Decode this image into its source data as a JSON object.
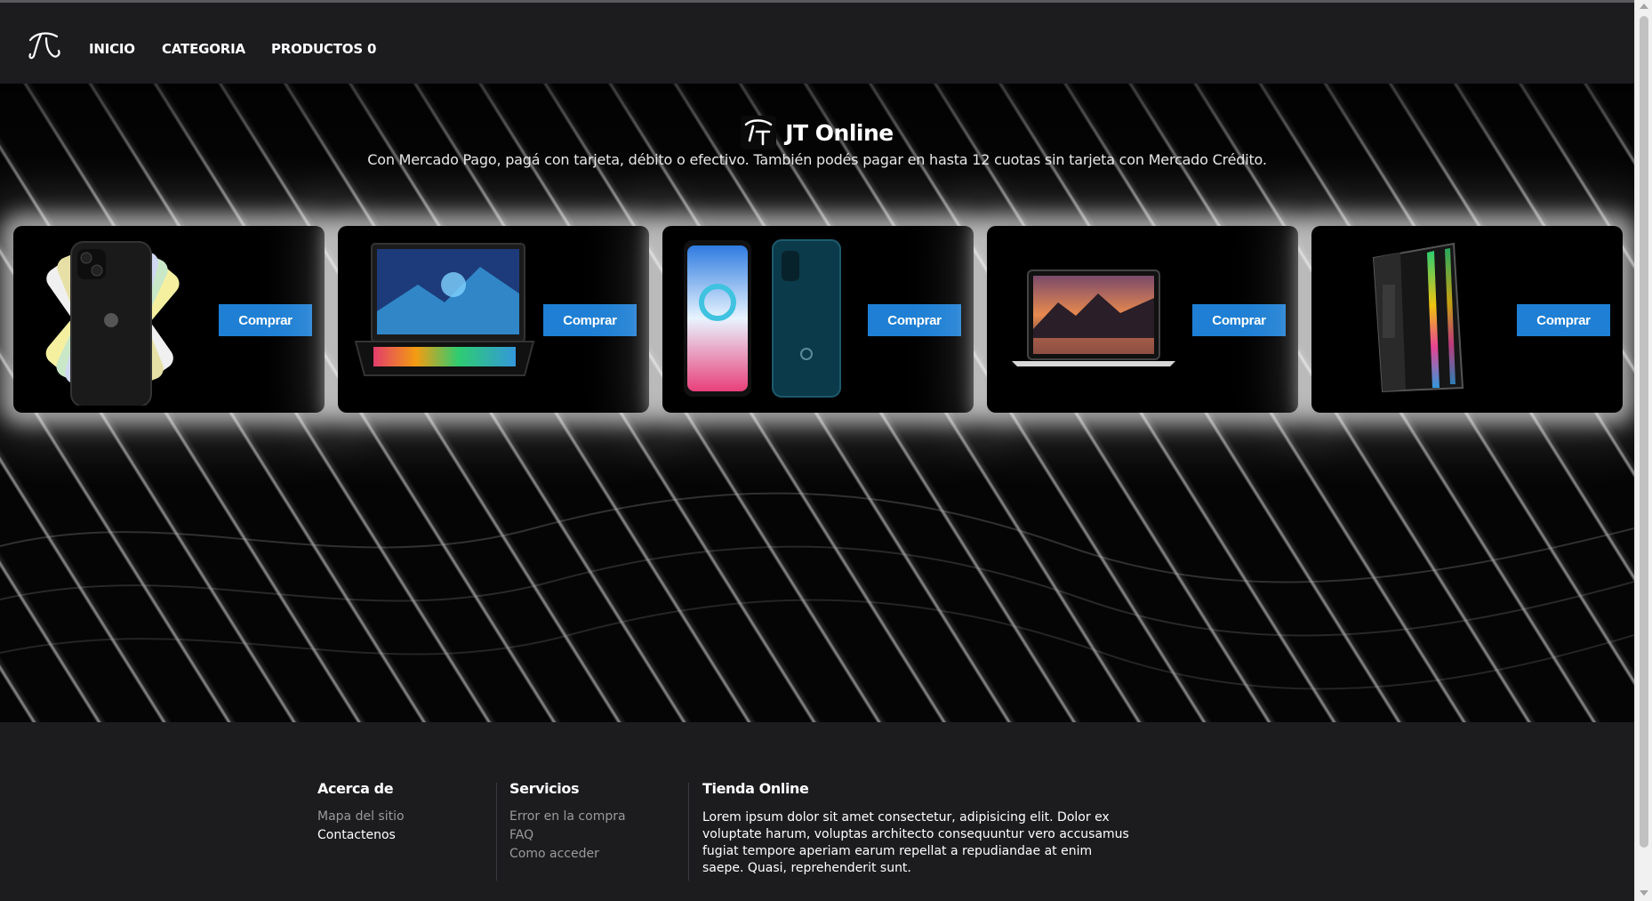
{
  "nav": {
    "logo_icon": "jt-signature-logo",
    "links": [
      "INICIO",
      "CATEGORIA",
      "PRODUCTOS 0"
    ]
  },
  "hero": {
    "logo_icon": "jt-logo",
    "title": "JT Online",
    "subtitle": "Con Mercado Pago, pagá con tarjeta, débito o efectivo. También podés pagar en hasta 12 cuotas sin tarjeta con Mercado Crédito."
  },
  "products": [
    {
      "image": "iphone-colors",
      "button": "Comprar"
    },
    {
      "image": "gaming-laptop",
      "button": "Comprar"
    },
    {
      "image": "alcatel-phones",
      "button": "Comprar"
    },
    {
      "image": "macbook-laptop",
      "button": "Comprar"
    },
    {
      "image": "pc-tower",
      "button": "Comprar"
    }
  ],
  "footer": {
    "about": {
      "title": "Acerca de",
      "links": [
        "Mapa del sitio",
        "Contactenos"
      ]
    },
    "services": {
      "title": "Servicios",
      "links": [
        "Error en la compra",
        "FAQ",
        "Como acceder"
      ]
    },
    "store": {
      "title": "Tienda Online",
      "text": "Lorem ipsum dolor sit amet consectetur, adipisicing elit. Dolor ex voluptate harum, voluptas architecto consequuntur vero accusamus fugiat tempore aperiam earum repellat a repudiandae at enim saepe. Quasi, reprehenderit sunt."
    }
  },
  "colors": {
    "accent": "#1e7fd4",
    "background": "#1c1c1f",
    "hero_bg": "#050505"
  }
}
